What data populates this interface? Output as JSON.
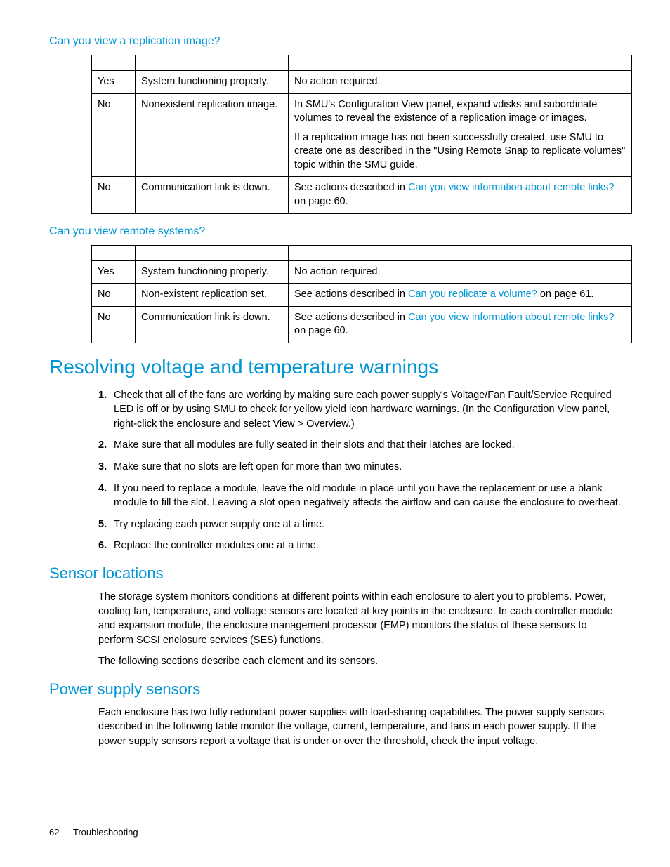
{
  "sections": {
    "replication_image": {
      "heading": "Can you view a replication image?",
      "rows": [
        {
          "answer": "Yes",
          "cause": "System functioning properly.",
          "actions": [
            "No action required."
          ]
        },
        {
          "answer": "No",
          "cause": "Nonexistent replication image.",
          "actions": [
            "In SMU's Configuration View panel, expand vdisks and subordinate volumes to reveal the existence of a replication image or images.",
            "If a replication image has not been successfully created, use SMU to create one as described in the \"Using Remote Snap to replicate volumes\" topic within the SMU guide."
          ]
        },
        {
          "answer": "No",
          "cause": "Communication link is down.",
          "actions_pre": "See actions described in ",
          "actions_link": "Can you view information about remote links?",
          "actions_post": " on page 60."
        }
      ]
    },
    "remote_systems": {
      "heading": "Can you view remote systems?",
      "rows": [
        {
          "answer": "Yes",
          "cause": "System functioning properly.",
          "actions": [
            "No action required."
          ]
        },
        {
          "answer": "No",
          "cause": "Non-existent replication set.",
          "actions_pre": "See actions described in ",
          "actions_link": "Can you replicate a volume?",
          "actions_post": " on page 61."
        },
        {
          "answer": "No",
          "cause": "Communication link is down.",
          "actions_pre": "See actions described in ",
          "actions_link": "Can you view information about remote links?",
          "actions_post": " on page 60."
        }
      ]
    },
    "voltage_temp": {
      "heading": "Resolving voltage and temperature warnings",
      "steps": [
        "Check that all of the fans are working by making sure each power supply's Voltage/Fan Fault/Service Required LED is off or by using SMU to check for yellow yield icon hardware warnings. (In the Configuration View panel, right-click the enclosure and select View > Overview.)",
        "Make sure that all modules are fully seated in their slots and that their latches are locked.",
        "Make sure that no slots are left open for more than two minutes.",
        "If you need to replace a module, leave the old module in place until you have the replacement or use a blank module to fill the slot. Leaving a slot open negatively affects the airflow and can cause the enclosure to overheat.",
        "Try replacing each power supply one at a time.",
        "Replace the controller modules one at a time."
      ]
    },
    "sensor_locations": {
      "heading": "Sensor locations",
      "paras": [
        "The storage system monitors conditions at different points within each enclosure to alert you to problems. Power, cooling fan, temperature, and voltage sensors are located at key points in the enclosure. In each controller module and expansion module, the enclosure management processor (EMP) monitors the status of these sensors to perform SCSI enclosure services (SES) functions.",
        "The following sections describe each element and its sensors."
      ]
    },
    "power_supply_sensors": {
      "heading": "Power supply sensors",
      "paras": [
        "Each enclosure has two fully redundant power supplies with load-sharing capabilities. The power supply sensors described in the following table monitor the voltage, current, temperature, and fans in each power supply. If the power supply sensors report a voltage that is under or over the threshold, check the input voltage."
      ]
    }
  },
  "footer": {
    "page": "62",
    "section": "Troubleshooting"
  }
}
